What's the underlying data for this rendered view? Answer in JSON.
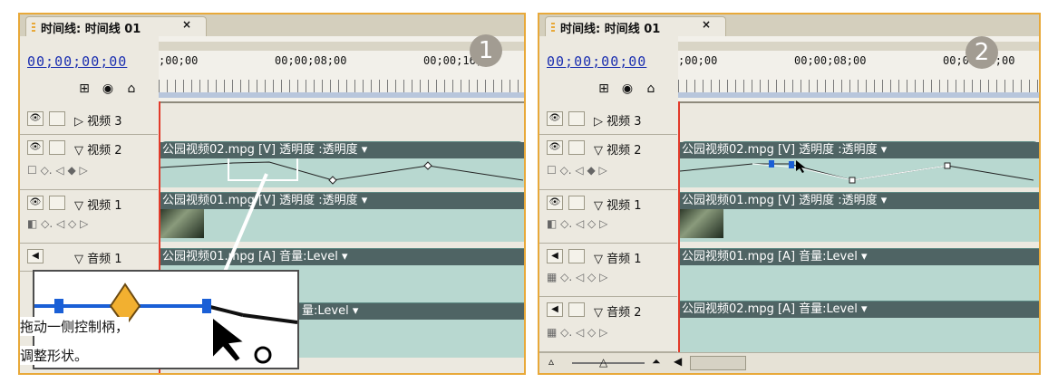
{
  "panels": [
    {
      "step": "1",
      "tab_title": "时间线: 时间线 01",
      "tab_close": "×",
      "timecode": "00;00;00;00",
      "ruler_labels": [
        ";00;00",
        "00;00;08;00",
        "00;00;16;00"
      ],
      "tracks": {
        "video3": {
          "label": "视频 3"
        },
        "video2": {
          "label": "视频 2",
          "clip": "公园视频02.mpg [V] 透明度 :透明度 ▾"
        },
        "video1": {
          "label": "视频 1",
          "clip": "公园视频01.mpg [V] 透明度 :透明度 ▾"
        },
        "audio1": {
          "label": "音频 1",
          "clip": "公园视频01.mpg [A] 音量:Level ▾"
        },
        "audio2": {
          "clip": "量:Level ▾"
        }
      },
      "callout": {
        "line1": "拖动一侧控制柄，",
        "line2": "调整形状。"
      }
    },
    {
      "step": "2",
      "tab_title": "时间线: 时间线 01",
      "tab_close": "×",
      "timecode": "00;00;00;00",
      "ruler_labels": ";00;00",
      "ruler_labels_2": "00;00;08;00",
      "ruler_labels_3": "00;00;16;00",
      "tracks": {
        "video3": {
          "label": "视频 3"
        },
        "video2": {
          "label": "视频 2",
          "clip": "公园视频02.mpg [V] 透明度 :透明度 ▾"
        },
        "video1": {
          "label": "视频 1",
          "clip": "公园视频01.mpg [V] 透明度 :透明度 ▾"
        },
        "audio1": {
          "label": "音频 1",
          "clip": "公园视频01.mpg [A] 音量:Level ▾"
        },
        "audio2": {
          "label": "音频 2",
          "clip": "公园视频02.mpg [A] 音量:Level ▾"
        }
      }
    }
  ],
  "colors": {
    "accent": "#e8a93a",
    "timecode": "#1b2fb0",
    "playhead": "#e23a2a",
    "clip": "#b8d8d0",
    "clip_header": "#4f6464"
  },
  "icons": [
    "eye-icon",
    "lock-icon",
    "triangle-expand-icon",
    "keyframe-icon",
    "speaker-icon",
    "cursor-icon"
  ]
}
